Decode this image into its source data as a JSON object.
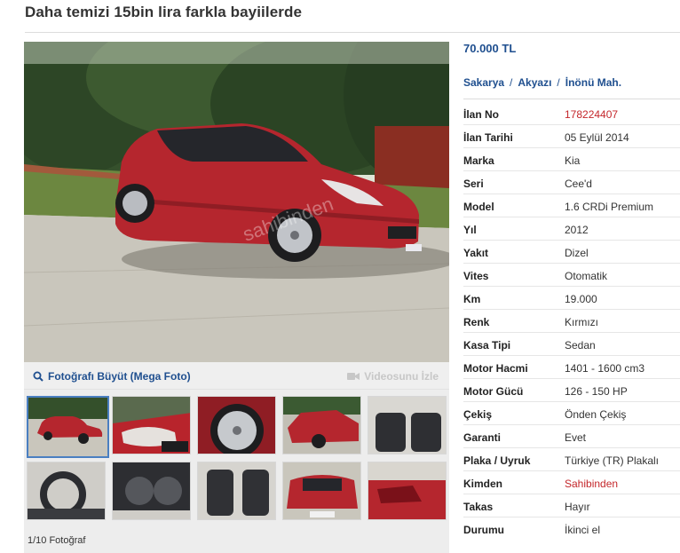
{
  "listing": {
    "title": "Daha temizi 15bin lira farkla bayiilerde",
    "price": "70.000 TL",
    "location": {
      "city": "Sakarya",
      "district": "Akyazı",
      "neighborhood": "İnönü Mah.",
      "separator": "/"
    }
  },
  "gallery": {
    "enlarge_label": "Fotoğrafı Büyüt (Mega Foto)",
    "video_label": "Videosunu İzle",
    "counter": "1/10 Fotoğraf",
    "watermark": "sahibinden",
    "selected_index": 0,
    "thumbnails": [
      {
        "subject": "car-front-three-quarter"
      },
      {
        "subject": "headlight-closeup"
      },
      {
        "subject": "alloy-wheel"
      },
      {
        "subject": "car-side-front"
      },
      {
        "subject": "rear-seats-interior"
      },
      {
        "subject": "steering-wheel-dashboard"
      },
      {
        "subject": "instrument-cluster"
      },
      {
        "subject": "front-seats-interior"
      },
      {
        "subject": "car-rear-view"
      },
      {
        "subject": "taillight-closeup"
      }
    ]
  },
  "specs": [
    {
      "key": "İlan No",
      "value": "178224407",
      "highlight": true
    },
    {
      "key": "İlan Tarihi",
      "value": "05 Eylül 2014"
    },
    {
      "key": "Marka",
      "value": "Kia"
    },
    {
      "key": "Seri",
      "value": "Cee'd"
    },
    {
      "key": "Model",
      "value": "1.6 CRDi Premium"
    },
    {
      "key": "Yıl",
      "value": "2012"
    },
    {
      "key": "Yakıt",
      "value": "Dizel"
    },
    {
      "key": "Vites",
      "value": "Otomatik"
    },
    {
      "key": "Km",
      "value": "19.000"
    },
    {
      "key": "Renk",
      "value": "Kırmızı"
    },
    {
      "key": "Kasa Tipi",
      "value": "Sedan"
    },
    {
      "key": "Motor Hacmi",
      "value": "1401 - 1600 cm3"
    },
    {
      "key": "Motor Gücü",
      "value": "126 - 150 HP"
    },
    {
      "key": "Çekiş",
      "value": "Önden Çekiş"
    },
    {
      "key": "Garanti",
      "value": "Evet"
    },
    {
      "key": "Plaka / Uyruk",
      "value": "Türkiye (TR) Plakalı"
    },
    {
      "key": "Kimden",
      "value": "Sahibinden",
      "highlight": true
    },
    {
      "key": "Takas",
      "value": "Hayır"
    },
    {
      "key": "Durumu",
      "value": "İkinci el"
    }
  ],
  "colors": {
    "link": "#1f4f8f",
    "highlight": "#c4272b",
    "car_red": "#b5262e"
  }
}
